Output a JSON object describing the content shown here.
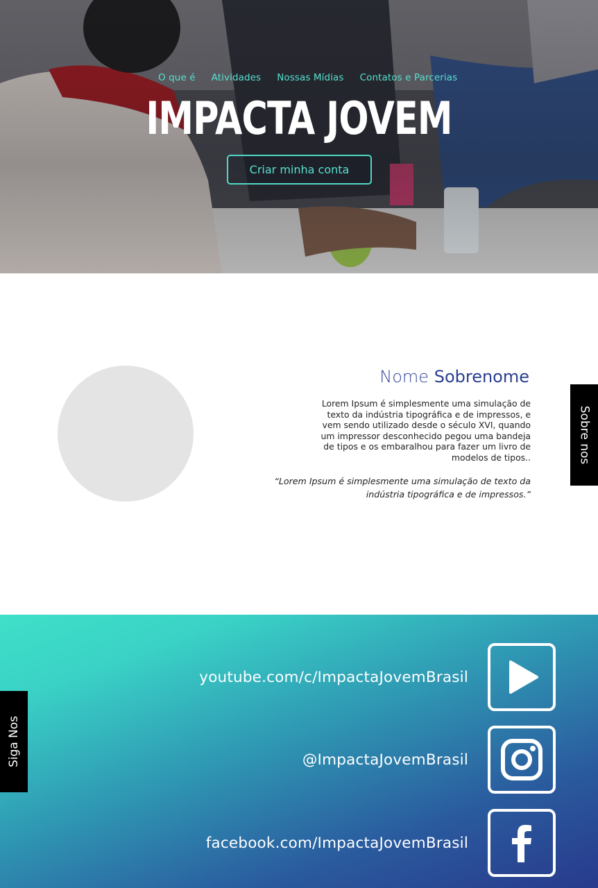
{
  "hero": {
    "nav": [
      "O que é",
      "Atividades",
      "Nossas Mídias",
      "Contatos e Parcerias"
    ],
    "logo": "IMPACTA JOVEM",
    "cta": "Criar minha conta"
  },
  "about": {
    "name_first": "Nome",
    "name_last": "Sobrenome",
    "bio": "Lorem Ipsum é simplesmente uma simulação de texto da indústria tipográfica e de impressos, e vem sendo utilizado desde o século XVI, quando um impressor desconhecido pegou uma bandeja de tipos e os embaralhou para fazer um livro de modelos de tipos..",
    "quote": "“Lorem Ipsum é simplesmente uma simulação de texto da indústria tipográfica e de impressos.”",
    "tab_label": "Sobre nos"
  },
  "social": {
    "tab_label": "Siga Nos",
    "links": [
      {
        "text": "youtube.com/c/ImpactaJovemBrasil",
        "icon": "youtube-play-icon"
      },
      {
        "text": "@ImpactaJovemBrasil",
        "icon": "instagram-icon"
      },
      {
        "text": "facebook.com/ImpactaJovemBrasil",
        "icon": "facebook-icon"
      }
    ]
  },
  "colors": {
    "accent": "#4fd9c8",
    "name_blue": "#2a3f8f",
    "gradient_top": "#3fe0c8",
    "gradient_bottom": "#283a8c"
  }
}
